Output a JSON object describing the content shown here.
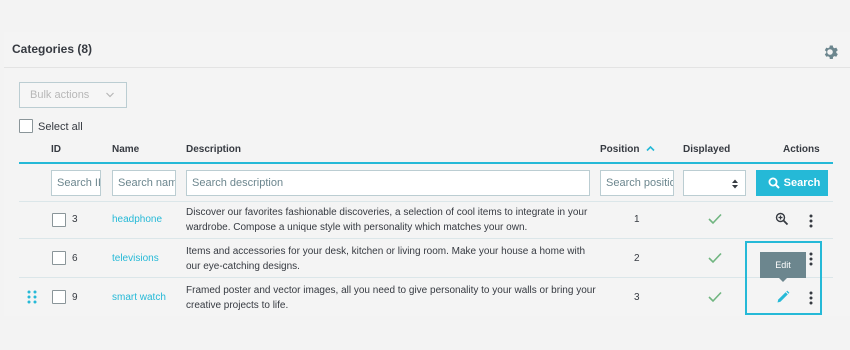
{
  "panel": {
    "title": "Categories (8)",
    "settings_icon": "gear-icon"
  },
  "toolbar": {
    "bulk_actions_label": "Bulk actions",
    "select_all_label": "Select all"
  },
  "table": {
    "columns": {
      "id": "ID",
      "name": "Name",
      "description": "Description",
      "position": "Position",
      "displayed": "Displayed",
      "actions": "Actions"
    },
    "sort": {
      "column": "position",
      "direction": "asc"
    },
    "filters": {
      "id_placeholder": "Search ID",
      "name_placeholder": "Search name",
      "description_placeholder": "Search description",
      "position_placeholder": "Search position",
      "displayed_value": "",
      "search_label": "Search"
    },
    "rows": [
      {
        "id": "3",
        "name": "headphone",
        "description": "Discover our favorites fashionable discoveries, a selection of cool items to integrate in your wardrobe. Compose a unique style with personality which matches your own.",
        "position": "1",
        "displayed": true
      },
      {
        "id": "6",
        "name": "televisions",
        "description": "Items and accessories for your desk, kitchen or living room. Make your house a home with our eye-catching designs.",
        "position": "2",
        "displayed": true
      },
      {
        "id": "9",
        "name": "smart watch",
        "description": "Framed poster and vector images, all you need to give personality to your walls or bring your creative projects to life.",
        "position": "3",
        "displayed": true
      }
    ]
  },
  "tooltip": {
    "text": "Edit"
  },
  "colors": {
    "accent": "#25b9d7",
    "check": "#70b580",
    "tooltip_bg": "#6c868e"
  }
}
